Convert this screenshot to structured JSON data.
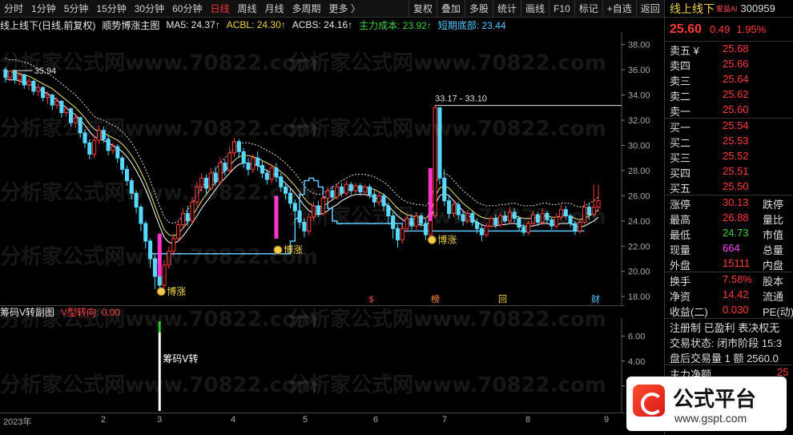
{
  "toolbar": {
    "periods": [
      "分时",
      "1分钟",
      "5分钟",
      "15分钟",
      "30分钟",
      "60分钟",
      "日线",
      "周线",
      "月线",
      "多周期",
      "更多 〉"
    ],
    "active_index": 6,
    "tools": [
      "复权",
      "叠加",
      "多股",
      "统计",
      "画线",
      "F10",
      "标记",
      "+自选",
      "返回"
    ]
  },
  "chart_info": {
    "title": "线上线下(日线,前复权)",
    "indicator": "顺势博涨主图",
    "ma5": "MA5: 24.37↑",
    "acbl": "ACBL: 24.30↑",
    "acbs": "ACBS: 24.16↑",
    "main_cost": "主力成本: 23.92↑",
    "short_bottom": "短期底部: 23.44"
  },
  "main_axis": {
    "ticks": [
      "38.00",
      "36.00",
      "34.00",
      "32.00",
      "30.00",
      "28.00",
      "26.00",
      "24.00",
      "22.00",
      "20.00",
      "18.00"
    ]
  },
  "annotations": {
    "high_label": "35.94",
    "spike_label": "33.17 - 33.10",
    "signal_label": "博涨",
    "event_tags": [
      "$",
      "榜",
      "回",
      "财"
    ]
  },
  "sub_info": {
    "name": "筹码V转副图",
    "value_label": "V型转向: 0.00"
  },
  "sub_axis": {
    "ticks": [
      "6.00",
      "4.00",
      "2.00"
    ]
  },
  "sub_annotation": "筹码V转",
  "date_axis": {
    "labels": [
      "2023年",
      "2",
      "3",
      "4",
      "5",
      "6",
      "7",
      "8",
      "9"
    ]
  },
  "watermark": "分析家公式网www.70822.com",
  "quote": {
    "name": "线上线下",
    "ai_tag": "爱益AI",
    "code": "300959",
    "price": "25.60",
    "change": "0.49",
    "change_pct": "1.95%",
    "asks": [
      {
        "label": "卖五 ¥",
        "price": "25.68"
      },
      {
        "label": "卖四",
        "price": "25.66"
      },
      {
        "label": "卖三",
        "price": "25.64"
      },
      {
        "label": "卖二",
        "price": "25.62"
      },
      {
        "label": "卖一",
        "price": "25.60"
      }
    ],
    "bids": [
      {
        "label": "买一",
        "price": "25.54"
      },
      {
        "label": "买二",
        "price": "25.53"
      },
      {
        "label": "买三",
        "price": "25.52"
      },
      {
        "label": "买四",
        "price": "25.51"
      },
      {
        "label": "买五",
        "price": "25.50"
      }
    ],
    "stats1": [
      {
        "label": "涨停",
        "value": "30.13",
        "label2": "跌停"
      },
      {
        "label": "最高",
        "value": "26.88",
        "label2": "量比"
      },
      {
        "label": "最低",
        "value": "24.73",
        "label2": "市值"
      },
      {
        "label": "现量",
        "value": "664",
        "label2": "总量"
      },
      {
        "label": "外盘",
        "value": "15111",
        "label2": "内盘"
      }
    ],
    "stats2": [
      {
        "label": "换手",
        "value": "7.58%",
        "label2": "股本"
      },
      {
        "label": "净资",
        "value": "14.42",
        "label2": "流通"
      },
      {
        "label": "收益(二)",
        "value": "0.030",
        "label2": "PE(动)"
      }
    ],
    "info_lines": [
      "注册制 已盈利 表决权无",
      "交易状态: 闭市阶段 15:3",
      "盘后交易量 1 额 2560.0"
    ],
    "main_net_label": "主力净额",
    "main_net_value": "25"
  },
  "brand": {
    "title": "公式平台",
    "url": "www.gspt.com"
  },
  "chart_data": {
    "type": "candlestick",
    "y_range": [
      17.5,
      39.0
    ],
    "sub_y_range": [
      0,
      7.2
    ],
    "candles": [
      [
        36.0,
        35.4,
        36.2,
        35.0
      ],
      [
        35.4,
        35.9,
        35.94,
        35.1
      ],
      [
        35.9,
        35.2,
        36.0,
        34.9
      ],
      [
        35.2,
        35.6,
        35.8,
        34.8
      ],
      [
        35.6,
        34.8,
        35.7,
        34.5
      ],
      [
        34.8,
        35.1,
        35.3,
        34.4
      ],
      [
        35.1,
        34.3,
        35.2,
        34.0
      ],
      [
        34.3,
        34.6,
        34.9,
        33.9
      ],
      [
        34.6,
        33.8,
        34.7,
        33.5
      ],
      [
        33.8,
        34.0,
        34.3,
        33.3
      ],
      [
        34.0,
        33.2,
        34.1,
        32.8
      ],
      [
        33.2,
        33.5,
        33.8,
        32.9
      ],
      [
        33.5,
        32.6,
        33.6,
        32.2
      ],
      [
        32.6,
        32.9,
        33.1,
        32.3
      ],
      [
        32.9,
        31.8,
        33.0,
        31.5
      ],
      [
        31.8,
        32.2,
        32.5,
        31.4
      ],
      [
        32.2,
        31.0,
        32.3,
        30.6
      ],
      [
        31.0,
        30.2,
        31.3,
        29.8
      ],
      [
        30.2,
        29.3,
        30.5,
        28.9
      ],
      [
        29.3,
        30.4,
        30.8,
        29.0
      ],
      [
        30.4,
        31.2,
        31.6,
        30.1
      ],
      [
        31.2,
        30.5,
        31.5,
        30.2
      ],
      [
        30.5,
        29.6,
        30.8,
        29.2
      ],
      [
        29.6,
        29.9,
        30.2,
        29.3
      ],
      [
        29.9,
        29.0,
        30.1,
        28.6
      ],
      [
        29.0,
        28.1,
        29.2,
        27.7
      ],
      [
        28.1,
        27.2,
        28.4,
        26.8
      ],
      [
        27.2,
        26.2,
        27.4,
        25.7
      ],
      [
        26.2,
        25.1,
        26.4,
        24.6
      ],
      [
        25.1,
        23.8,
        25.3,
        23.2
      ],
      [
        23.8,
        22.4,
        24.0,
        21.8
      ],
      [
        22.4,
        21.0,
        22.6,
        20.3
      ],
      [
        21.0,
        19.6,
        21.3,
        18.6
      ],
      [
        19.6,
        18.9,
        20.1,
        18.3
      ],
      [
        18.9,
        20.5,
        20.9,
        18.7
      ],
      [
        20.5,
        21.6,
        22.0,
        20.2
      ],
      [
        21.6,
        22.6,
        23.0,
        21.3
      ],
      [
        22.6,
        23.7,
        24.1,
        22.3
      ],
      [
        23.7,
        24.6,
        25.0,
        23.4
      ],
      [
        24.6,
        24.0,
        25.2,
        23.6
      ],
      [
        24.0,
        25.5,
        25.9,
        23.8
      ],
      [
        25.5,
        26.7,
        27.1,
        25.2
      ],
      [
        26.7,
        27.4,
        27.8,
        26.3
      ],
      [
        27.4,
        26.6,
        27.7,
        26.2
      ],
      [
        26.6,
        27.8,
        28.2,
        26.4
      ],
      [
        27.8,
        27.1,
        28.3,
        26.8
      ],
      [
        27.1,
        28.6,
        29.0,
        26.9
      ],
      [
        28.6,
        28.0,
        28.9,
        27.6
      ],
      [
        28.0,
        29.4,
        29.9,
        27.8
      ],
      [
        29.4,
        30.3,
        30.6,
        29.1
      ],
      [
        30.3,
        29.5,
        30.5,
        29.0
      ],
      [
        29.5,
        28.6,
        29.8,
        28.2
      ],
      [
        28.6,
        28.1,
        29.0,
        27.6
      ],
      [
        28.1,
        29.0,
        29.3,
        27.8
      ],
      [
        29.0,
        28.4,
        29.5,
        28.0
      ],
      [
        28.4,
        27.8,
        28.8,
        27.4
      ],
      [
        27.8,
        27.3,
        28.1,
        26.9
      ],
      [
        27.3,
        28.2,
        28.5,
        27.0
      ],
      [
        28.2,
        27.5,
        28.6,
        27.1
      ],
      [
        27.5,
        26.7,
        27.8,
        26.3
      ],
      [
        26.7,
        26.2,
        27.0,
        25.7
      ],
      [
        26.2,
        25.4,
        26.5,
        25.0
      ],
      [
        25.4,
        24.8,
        25.7,
        24.3
      ],
      [
        24.8,
        23.9,
        25.1,
        23.4
      ],
      [
        23.9,
        23.2,
        24.2,
        22.7
      ],
      [
        23.2,
        24.3,
        24.6,
        22.9
      ],
      [
        24.3,
        25.2,
        25.5,
        24.0
      ],
      [
        25.2,
        24.6,
        25.6,
        24.3
      ],
      [
        24.6,
        25.8,
        26.1,
        24.4
      ],
      [
        25.8,
        26.4,
        26.7,
        25.5
      ],
      [
        26.4,
        25.9,
        26.8,
        25.6
      ],
      [
        25.9,
        26.7,
        27.0,
        25.7
      ],
      [
        26.7,
        26.2,
        27.0,
        25.9
      ],
      [
        26.2,
        26.9,
        27.2,
        26.0
      ],
      [
        26.9,
        26.4,
        27.1,
        26.1
      ],
      [
        26.4,
        26.8,
        27.0,
        26.2
      ],
      [
        26.8,
        26.3,
        27.0,
        26.0
      ],
      [
        26.3,
        26.7,
        26.9,
        26.0
      ],
      [
        26.7,
        26.1,
        26.9,
        25.8
      ],
      [
        26.1,
        25.5,
        26.4,
        25.1
      ],
      [
        25.5,
        26.0,
        26.2,
        25.2
      ],
      [
        26.0,
        25.2,
        26.2,
        24.8
      ],
      [
        25.2,
        24.4,
        25.5,
        23.8
      ],
      [
        24.4,
        23.4,
        24.7,
        22.6
      ],
      [
        23.4,
        22.5,
        23.7,
        21.9
      ],
      [
        22.5,
        23.4,
        23.7,
        22.2
      ],
      [
        23.4,
        24.2,
        24.5,
        23.1
      ],
      [
        24.2,
        23.6,
        24.5,
        23.3
      ],
      [
        23.6,
        24.4,
        24.7,
        23.3
      ],
      [
        24.4,
        23.8,
        24.6,
        23.5
      ],
      [
        23.8,
        22.9,
        24.1,
        22.5
      ],
      [
        22.9,
        24.4,
        27.0,
        22.7
      ],
      [
        24.4,
        33.0,
        33.17,
        24.2
      ],
      [
        33.0,
        27.4,
        30.2,
        26.9
      ],
      [
        27.4,
        25.6,
        28.1,
        25.2
      ],
      [
        25.6,
        24.6,
        26.1,
        24.2
      ],
      [
        24.6,
        25.3,
        25.6,
        24.3
      ],
      [
        25.3,
        24.5,
        25.5,
        24.1
      ],
      [
        24.5,
        24.0,
        24.8,
        23.6
      ],
      [
        24.0,
        24.6,
        24.9,
        23.8
      ],
      [
        24.6,
        23.9,
        24.8,
        23.6
      ],
      [
        23.9,
        23.4,
        24.2,
        23.0
      ],
      [
        23.4,
        22.9,
        23.7,
        22.4
      ],
      [
        22.9,
        23.6,
        23.9,
        22.7
      ],
      [
        23.6,
        24.2,
        24.4,
        23.4
      ],
      [
        24.2,
        23.7,
        24.5,
        23.4
      ],
      [
        23.7,
        24.4,
        24.7,
        23.5
      ],
      [
        24.4,
        24.0,
        24.8,
        23.8
      ],
      [
        24.0,
        24.7,
        25.1,
        23.8
      ],
      [
        24.7,
        24.2,
        25.0,
        23.9
      ],
      [
        24.2,
        23.5,
        24.4,
        23.2
      ],
      [
        23.5,
        23.1,
        23.8,
        22.8
      ],
      [
        23.1,
        23.8,
        24.0,
        22.9
      ],
      [
        23.8,
        24.5,
        24.8,
        23.6
      ],
      [
        24.5,
        23.9,
        24.7,
        23.6
      ],
      [
        23.9,
        24.6,
        25.0,
        23.7
      ],
      [
        24.6,
        24.1,
        24.8,
        23.8
      ],
      [
        24.1,
        23.6,
        24.3,
        23.3
      ],
      [
        23.6,
        24.3,
        24.6,
        23.4
      ],
      [
        24.3,
        24.9,
        25.3,
        24.1
      ],
      [
        24.9,
        24.4,
        25.2,
        24.1
      ],
      [
        24.4,
        23.8,
        24.6,
        23.5
      ],
      [
        23.8,
        23.2,
        24.0,
        22.9
      ],
      [
        23.2,
        23.9,
        24.1,
        23.0
      ],
      [
        23.9,
        25.1,
        25.6,
        23.7
      ],
      [
        25.1,
        24.5,
        25.4,
        24.1
      ],
      [
        24.5,
        25.11,
        26.88,
        24.3
      ],
      [
        25.11,
        25.6,
        26.88,
        24.73
      ]
    ],
    "ma_line": [
      35.6,
      35.5,
      35.5,
      35.4,
      35.3,
      35.2,
      35.0,
      34.8,
      34.6,
      34.4,
      34.2,
      33.9,
      33.6,
      33.3,
      33.0,
      32.7,
      32.3,
      31.9,
      31.4,
      31.0,
      30.8,
      30.7,
      30.5,
      30.3,
      30.1,
      29.8,
      29.4,
      28.9,
      28.3,
      27.6,
      26.8,
      25.9,
      24.9,
      23.9,
      23.0,
      22.6,
      22.5,
      22.7,
      23.1,
      23.6,
      24.1,
      24.7,
      25.3,
      25.8,
      26.3,
      26.8,
      27.3,
      27.7,
      28.1,
      28.5,
      28.8,
      28.9,
      28.9,
      28.8,
      28.7,
      28.5,
      28.3,
      28.1,
      27.9,
      27.6,
      27.3,
      26.9,
      26.5,
      26.0,
      25.5,
      25.1,
      24.9,
      24.8,
      24.9,
      25.1,
      25.4,
      25.6,
      25.9,
      26.1,
      26.3,
      26.4,
      26.4,
      26.4,
      26.3,
      26.2,
      26.0,
      25.8,
      25.5,
      25.1,
      24.7,
      24.4,
      24.2,
      24.1,
      24.0,
      24.0,
      23.9,
      24.3,
      25.6,
      26.3,
      26.5,
      26.3,
      25.9,
      25.5,
      25.1,
      24.8,
      24.5,
      24.2,
      24.0,
      23.9,
      23.9,
      23.9,
      24.0,
      24.0,
      24.1,
      24.1,
      24.0,
      23.9,
      23.9,
      23.9,
      24.0,
      24.1,
      24.1,
      24.0,
      24.0,
      24.1,
      24.1,
      24.1,
      23.9,
      23.8,
      23.9,
      24.1,
      24.3,
      24.6
    ],
    "cost_line": [
      [
        0,
        null
      ],
      [
        30,
        null
      ],
      [
        31,
        21.4
      ],
      [
        32,
        21.4
      ],
      [
        60,
        21.4
      ],
      [
        61,
        22.4
      ],
      [
        62,
        24.2
      ],
      [
        63,
        26.1
      ],
      [
        64,
        27.2
      ],
      [
        65,
        27.4
      ],
      [
        66,
        27.2
      ],
      [
        67,
        26.7
      ],
      [
        68,
        25.9
      ],
      [
        69,
        25.0
      ],
      [
        70,
        24.0
      ],
      [
        71,
        23.8
      ],
      [
        72,
        23.8
      ],
      [
        73,
        23.8
      ],
      [
        74,
        23.8
      ],
      [
        75,
        23.8
      ],
      [
        76,
        23.8
      ],
      [
        77,
        23.8
      ],
      [
        78,
        23.8
      ],
      [
        79,
        23.8
      ],
      [
        80,
        23.8
      ],
      [
        81,
        23.8
      ],
      [
        82,
        23.8
      ],
      [
        83,
        23.8
      ],
      [
        84,
        23.8
      ],
      [
        85,
        23.2
      ],
      [
        86,
        23.2
      ],
      [
        87,
        23.2
      ],
      [
        88,
        23.2
      ],
      [
        89,
        23.2
      ],
      [
        90,
        23.2
      ],
      [
        91,
        23.2
      ],
      [
        92,
        23.2
      ],
      [
        93,
        23.2
      ],
      [
        124,
        23.2
      ]
    ],
    "sub_values": [
      0,
      0,
      0,
      0,
      0,
      0,
      0,
      0,
      0,
      0,
      0,
      0,
      0,
      0,
      0,
      0,
      0,
      0,
      0,
      0,
      0,
      0,
      0,
      0,
      0,
      0,
      0,
      0,
      0,
      0,
      0,
      0,
      0,
      7.2,
      0,
      0,
      0,
      0,
      0,
      0,
      0,
      0,
      0,
      0,
      0,
      0,
      0,
      0,
      0,
      0,
      0,
      0,
      0,
      0,
      0,
      0,
      0,
      0,
      0,
      0,
      0,
      0,
      0,
      0,
      0,
      0,
      0,
      0,
      0,
      0,
      0,
      0,
      0,
      0,
      0,
      0,
      0,
      0,
      0,
      0,
      0,
      0,
      0,
      0,
      0,
      0,
      0,
      0,
      0,
      0,
      0,
      0,
      0,
      0,
      0,
      0,
      0,
      0,
      0,
      0,
      0,
      0,
      0,
      0,
      0,
      0,
      0,
      0,
      0,
      0,
      0,
      0,
      0,
      0,
      0,
      0,
      0,
      0,
      0,
      0,
      0,
      0,
      0,
      0
    ]
  }
}
